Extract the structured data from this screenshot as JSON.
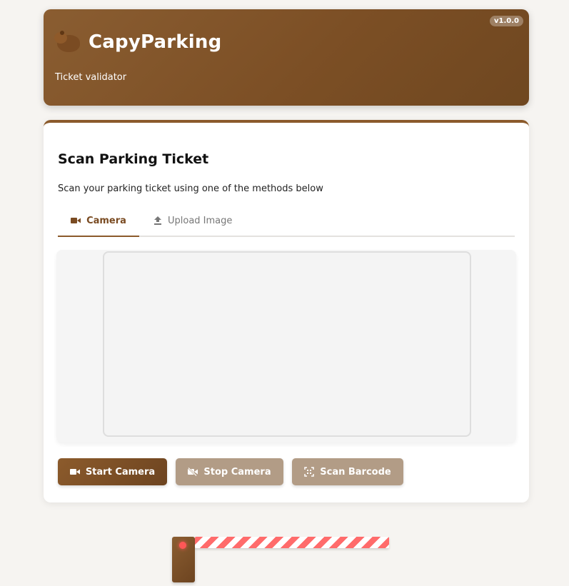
{
  "header": {
    "logo_icon": "capybara-icon",
    "title": "CapyParking",
    "subtitle": "Ticket validator",
    "version": "v1.0.0"
  },
  "card": {
    "title": "Scan Parking Ticket",
    "description": "Scan your parking ticket using one of the methods below",
    "tabs": [
      {
        "label": "Camera",
        "icon": "video-camera-icon",
        "active": true
      },
      {
        "label": "Upload Image",
        "icon": "upload-icon",
        "active": false
      }
    ],
    "buttons": {
      "start_camera": "Start Camera",
      "stop_camera": "Stop Camera",
      "scan_barcode": "Scan Barcode"
    }
  },
  "colors": {
    "brand_brown": "#7c4f25",
    "accent_brown": "#8b5a2b",
    "disabled_button": "#b29c86",
    "barrier_red": "#ff6b6b"
  }
}
